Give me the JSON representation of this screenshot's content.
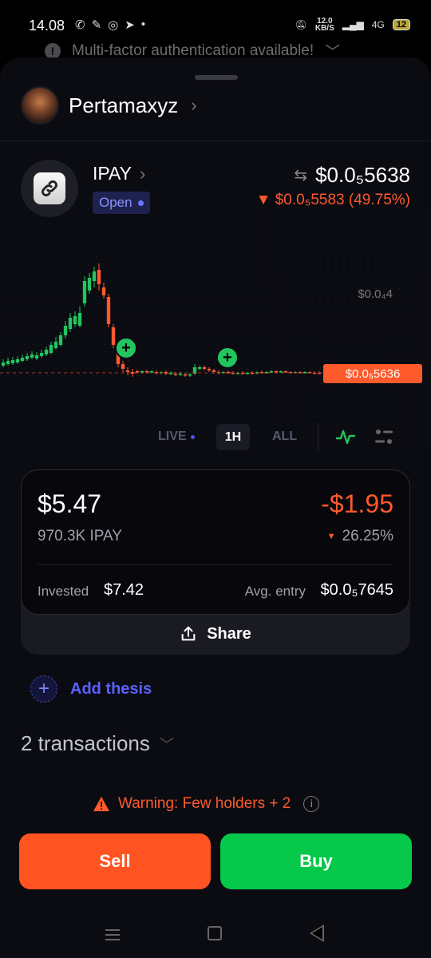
{
  "status_bar": {
    "time": "14.08",
    "net_speed_value": "12.0",
    "net_speed_unit": "KB/S",
    "network": "4G",
    "battery": "12"
  },
  "notification": {
    "text": "Multi-factor authentication available!"
  },
  "profile": {
    "name": "Pertamaxyz"
  },
  "token": {
    "symbol": "IPAY",
    "status": "Open",
    "price": "$0.0₅5638",
    "change": "▼ $0.0₅5583 (49.75%)"
  },
  "chart": {
    "axis_label": "$0.0₄4",
    "current_price_label": "$0.0₅5636",
    "colors": {
      "up": "#22c55e",
      "down": "#ff5a2c"
    }
  },
  "time_controls": {
    "live": "LIVE",
    "hour": "1H",
    "all": "ALL",
    "selected": "1H"
  },
  "position": {
    "value": "$5.47",
    "pnl": "-$1.95",
    "holding": "970.3K IPAY",
    "pnl_pct": "26.25%",
    "invested_label": "Invested",
    "invested_value": "$7.42",
    "avg_entry_label": "Avg. entry",
    "avg_entry_value": "$0.0₅7645",
    "share_label": "Share"
  },
  "thesis": {
    "label": "Add thesis"
  },
  "transactions": {
    "label": "2 transactions"
  },
  "warning": {
    "text": "Warning: Few holders + 2"
  },
  "actions": {
    "sell": "Sell",
    "buy": "Buy"
  }
}
